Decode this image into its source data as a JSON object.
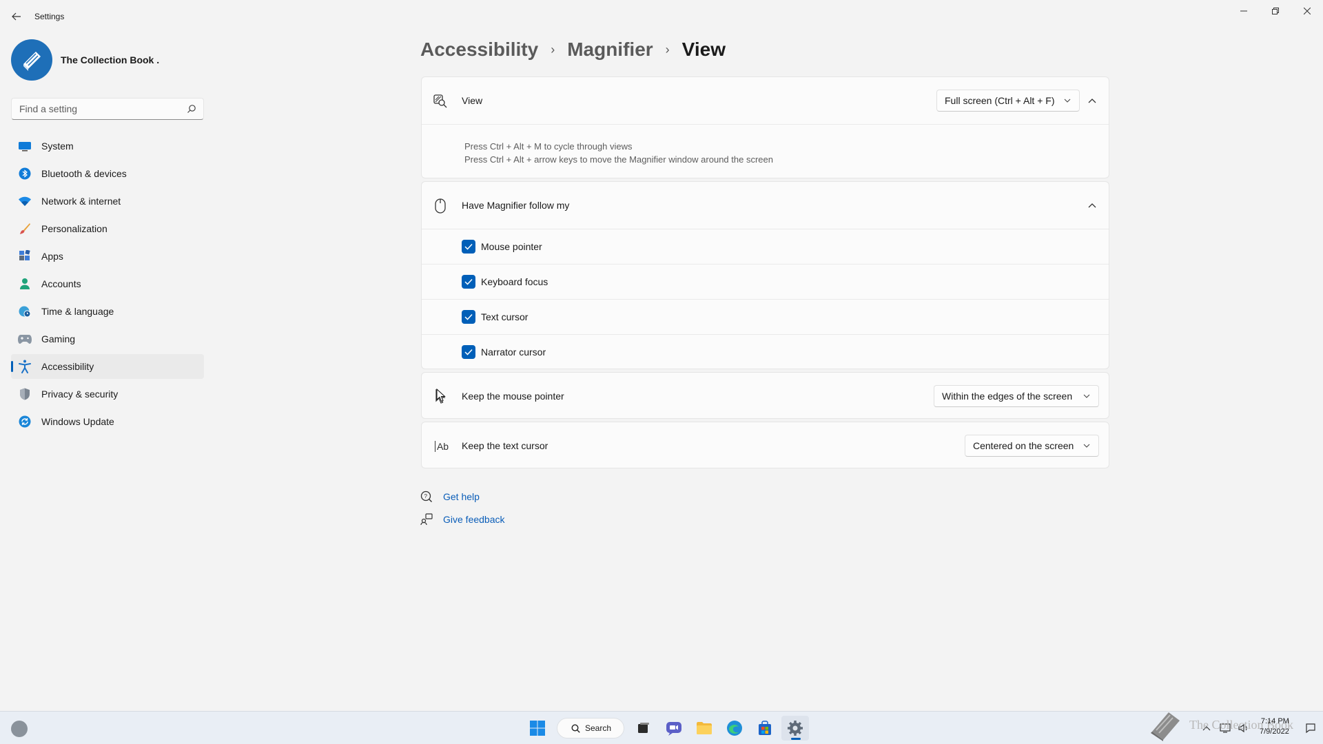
{
  "window": {
    "title": "Settings"
  },
  "profile": {
    "name": "The Collection Book ."
  },
  "search": {
    "placeholder": "Find a setting"
  },
  "sidebar": {
    "items": [
      {
        "label": "System",
        "icon": "system-icon"
      },
      {
        "label": "Bluetooth & devices",
        "icon": "bluetooth-icon"
      },
      {
        "label": "Network & internet",
        "icon": "wifi-icon"
      },
      {
        "label": "Personalization",
        "icon": "brush-icon"
      },
      {
        "label": "Apps",
        "icon": "apps-icon"
      },
      {
        "label": "Accounts",
        "icon": "person-icon"
      },
      {
        "label": "Time & language",
        "icon": "globe-clock-icon"
      },
      {
        "label": "Gaming",
        "icon": "gamepad-icon"
      },
      {
        "label": "Accessibility",
        "icon": "accessibility-icon",
        "active": true
      },
      {
        "label": "Privacy & security",
        "icon": "shield-icon"
      },
      {
        "label": "Windows Update",
        "icon": "update-icon"
      }
    ]
  },
  "breadcrumb": {
    "items": [
      "Accessibility",
      "Magnifier",
      "View"
    ]
  },
  "view_card": {
    "title": "View",
    "dropdown_value": "Full screen (Ctrl + Alt + F)",
    "info_line_1": "Press Ctrl + Alt + M to cycle through views",
    "info_line_2": "Press Ctrl + Alt + arrow keys to move the Magnifier window around the screen"
  },
  "follow_card": {
    "title": "Have Magnifier follow my",
    "options": [
      {
        "label": "Mouse pointer",
        "checked": true
      },
      {
        "label": "Keyboard focus",
        "checked": true
      },
      {
        "label": "Text cursor",
        "checked": true
      },
      {
        "label": "Narrator cursor",
        "checked": true
      }
    ]
  },
  "mouse_card": {
    "title": "Keep the mouse pointer",
    "dropdown_value": "Within the edges of the screen"
  },
  "text_card": {
    "title": "Keep the text cursor",
    "icon_text": "Ab",
    "dropdown_value": "Centered on the screen"
  },
  "links": {
    "help": "Get help",
    "feedback": "Give feedback"
  },
  "taskbar": {
    "search_label": "Search",
    "watermark": "The Collection Book",
    "time": "7:14 PM",
    "date": "7/9/2022"
  },
  "colors": {
    "accent": "#005fb8",
    "link": "#0a5db8",
    "background": "#f3f3f3"
  }
}
